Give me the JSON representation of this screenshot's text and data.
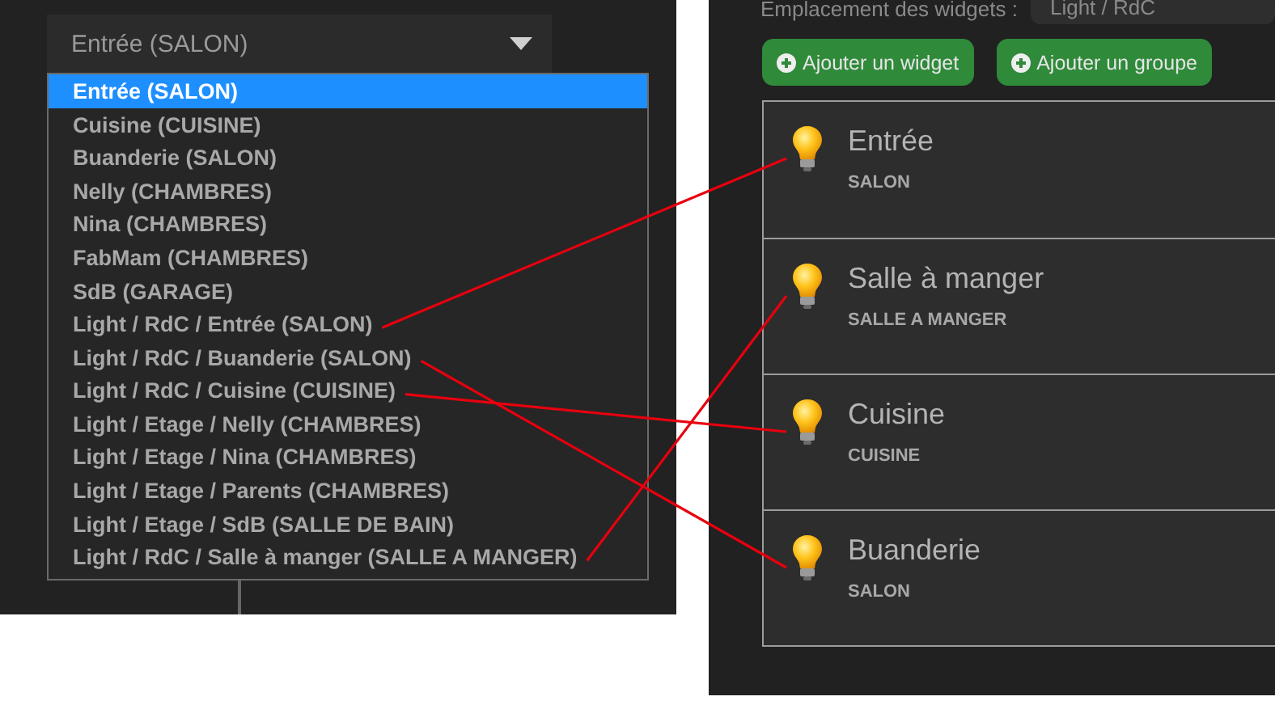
{
  "select": {
    "value": "Entrée (SALON)"
  },
  "options": [
    {
      "label": "Entrée (SALON)",
      "selected": true
    },
    {
      "label": "Cuisine (CUISINE)",
      "selected": false
    },
    {
      "label": "Buanderie (SALON)",
      "selected": false
    },
    {
      "label": "Nelly (CHAMBRES)",
      "selected": false
    },
    {
      "label": "Nina (CHAMBRES)",
      "selected": false
    },
    {
      "label": "FabMam (CHAMBRES)",
      "selected": false
    },
    {
      "label": "SdB (GARAGE)",
      "selected": false
    },
    {
      "label": "Light / RdC / Entrée (SALON)",
      "selected": false
    },
    {
      "label": "Light / RdC / Buanderie (SALON)",
      "selected": false
    },
    {
      "label": "Light / RdC / Cuisine (CUISINE)",
      "selected": false
    },
    {
      "label": "Light / Etage / Nelly (CHAMBRES)",
      "selected": false
    },
    {
      "label": "Light / Etage / Nina (CHAMBRES)",
      "selected": false
    },
    {
      "label": "Light / Etage / Parents (CHAMBRES)",
      "selected": false
    },
    {
      "label": "Light / Etage / SdB (SALLE DE BAIN)",
      "selected": false
    },
    {
      "label": "Light / RdC / Salle à manger (SALLE A MANGER)",
      "selected": false
    }
  ],
  "location": {
    "label": "Emplacement des widgets :",
    "value": "Light / RdC"
  },
  "buttons": [
    "Ajouter un widget",
    "Ajouter un groupe"
  ],
  "widgets": [
    {
      "title": "Entrée",
      "room": "SALON"
    },
    {
      "title": "Salle à manger",
      "room": "SALLE A MANGER"
    },
    {
      "title": "Cuisine",
      "room": "CUISINE"
    },
    {
      "title": "Buanderie",
      "room": "SALON"
    }
  ]
}
